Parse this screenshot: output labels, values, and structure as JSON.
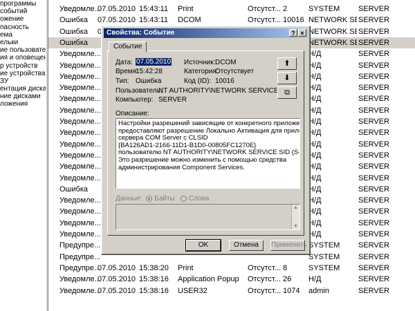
{
  "tree": [
    "программы",
    "событий",
    "ожение",
    "пасность",
    "ема",
    "ельки",
    "ие пользователи",
    "ия и оповещения пр",
    "р устройств",
    "ие устройства",
    "ЗУ",
    "ентация диска",
    "ние дисками",
    "ложения"
  ],
  "events": [
    {
      "icon": "info",
      "type": "Уведомле...",
      "date": "07.05.2010",
      "time": "15:43:11",
      "source": "Print",
      "category": "Отсутст...",
      "event": "2",
      "user": "SYSTEM",
      "computer": "SERVER"
    },
    {
      "icon": "error",
      "type": "Ошибка",
      "date": "07.05.2010",
      "time": "15:43:11",
      "source": "DCOM",
      "category": "Отсутст...",
      "event": "10016",
      "user": "NETWORK SER...",
      "computer": "SERVER"
    },
    {
      "icon": "error",
      "type": "Ошибка",
      "date": "07.05.2010",
      "time": "15:42:28",
      "source": "DCOM",
      "category": "Отсутст...",
      "event": "10016",
      "user": "NETWORK SER...",
      "computer": "SERVER"
    },
    {
      "icon": "error",
      "type": "Ошибка",
      "date": "",
      "time": "",
      "source": "",
      "category": "",
      "event": "",
      "user": "NETWORK SER...",
      "computer": "SERVER",
      "selected": true
    },
    {
      "icon": "info",
      "type": "Уведомле...",
      "date": "",
      "time": "",
      "source": "",
      "category": "",
      "event": "",
      "user": "Н/Д",
      "computer": "SERVER"
    },
    {
      "icon": "info",
      "type": "Уведомле...",
      "date": "",
      "time": "",
      "source": "",
      "category": "",
      "event": "",
      "user": "Н/Д",
      "computer": "SERVER"
    },
    {
      "icon": "info",
      "type": "Уведомле...",
      "date": "",
      "time": "",
      "source": "",
      "category": "",
      "event": "",
      "user": "Н/Д",
      "computer": "SERVER"
    },
    {
      "icon": "info",
      "type": "Уведомле...",
      "date": "",
      "time": "",
      "source": "",
      "category": "",
      "event": "",
      "user": "Н/Д",
      "computer": "SERVER"
    },
    {
      "icon": "info",
      "type": "Уведомле...",
      "date": "",
      "time": "",
      "source": "",
      "category": "",
      "event": "",
      "user": "Н/Д",
      "computer": "SERVER"
    },
    {
      "icon": "info",
      "type": "Уведомле...",
      "date": "",
      "time": "",
      "source": "",
      "category": "",
      "event": "",
      "user": "Н/Д",
      "computer": "SERVER"
    },
    {
      "icon": "info",
      "type": "Уведомле...",
      "date": "",
      "time": "",
      "source": "",
      "category": "",
      "event": "",
      "user": "Н/Д",
      "computer": "SERVER"
    },
    {
      "icon": "info",
      "type": "Уведомле...",
      "date": "",
      "time": "",
      "source": "",
      "category": "",
      "event": "",
      "user": "Н/Д",
      "computer": "SERVER"
    },
    {
      "icon": "info",
      "type": "Уведомле...",
      "date": "",
      "time": "",
      "source": "",
      "category": "",
      "event": "",
      "user": "Н/Д",
      "computer": "SERVER"
    },
    {
      "icon": "info",
      "type": "Уведомле...",
      "date": "",
      "time": "",
      "source": "",
      "category": "",
      "event": "",
      "user": "Н/Д",
      "computer": "SERVER"
    },
    {
      "icon": "info",
      "type": "Уведомле...",
      "date": "",
      "time": "",
      "source": "",
      "category": "",
      "event": "",
      "user": "Н/Д",
      "computer": "SERVER"
    },
    {
      "icon": "info",
      "type": "Уведомле...",
      "date": "",
      "time": "",
      "source": "",
      "category": "",
      "event": "",
      "user": "Н/Д",
      "computer": "SERVER"
    },
    {
      "icon": "error",
      "type": "Ошибка",
      "date": "",
      "time": "",
      "source": "",
      "category": "",
      "event": "",
      "user": "Н/Д",
      "computer": "SERVER"
    },
    {
      "icon": "info",
      "type": "Уведомле...",
      "date": "",
      "time": "",
      "source": "",
      "category": "",
      "event": "",
      "user": "Н/Д",
      "computer": "SERVER"
    },
    {
      "icon": "info",
      "type": "Уведомле...",
      "date": "",
      "time": "",
      "source": "",
      "category": "",
      "event": "",
      "user": "Н/Д",
      "computer": "SERVER"
    },
    {
      "icon": "info",
      "type": "Уведомле...",
      "date": "",
      "time": "",
      "source": "",
      "category": "",
      "event": "",
      "user": "Н/Д",
      "computer": "SERVER"
    },
    {
      "icon": "info",
      "type": "Уведомле...",
      "date": "",
      "time": "",
      "source": "",
      "category": "",
      "event": "",
      "user": "Н/Д",
      "computer": "SERVER"
    },
    {
      "icon": "warning",
      "type": "Предупре...",
      "date": "",
      "time": "",
      "source": "",
      "category": "",
      "event": "",
      "user": "SYSTEM",
      "computer": "SERVER"
    },
    {
      "icon": "warning",
      "type": "Предупре...",
      "date": "",
      "time": "",
      "source": "",
      "category": "",
      "event": "",
      "user": "SYSTEM",
      "computer": "SERVER"
    },
    {
      "icon": "warning",
      "type": "Предупре...",
      "date": "07.05.2010",
      "time": "15:38:20",
      "source": "Print",
      "category": "Отсутст...",
      "event": "8",
      "user": "SYSTEM",
      "computer": "SERVER"
    },
    {
      "icon": "info",
      "type": "Уведомле...",
      "date": "07.05.2010",
      "time": "15:38:16",
      "source": "Application Popup",
      "category": "Отсутст...",
      "event": "26",
      "user": "Н/Д",
      "computer": "SERVER"
    },
    {
      "icon": "info",
      "type": "Уведомле...",
      "date": "07.05.2010",
      "time": "15:38:16",
      "source": "USER32",
      "category": "Отсутст...",
      "event": "1074",
      "user": "admin",
      "computer": "SERVER"
    }
  ],
  "dialog": {
    "title": "Свойства: Событие",
    "help_btn": "?",
    "close_btn": "×",
    "tab": "Событие",
    "date_label": "Дата:",
    "date": "07.05.2010",
    "source_label": "Источник:",
    "source": "DCOM",
    "time_label": "Время:",
    "time": "15:42:28",
    "category_label": "Категория:",
    "category": "Отсутствует",
    "type_label": "Тип:",
    "type": "Ошибка",
    "code_label": "Код (ID):",
    "code": "10016",
    "user_label": "Пользователь:",
    "user": "NT AUTHORITY\\NETWORK SERVICE",
    "computer_label": "Компьютер:",
    "computer": "SERVER",
    "up_arrow": "⬆",
    "down_arrow": "⬇",
    "copy_icon": "⧉",
    "description_label": "Описание:",
    "description_lines": [
      "Настройки разрешений  зависящие от конкретного приложения не",
      "предоставляют разрешение Локально Активация для приложения",
      "сервера COM Server с CLSID",
      "{BA126AD1-2166-11D1-B1D0-00805FC1270E}",
      " пользователю NT AUTHORITY\\NETWORK SERVICE SID (S-1-5-20).",
      "Это разрешение  можно изменить с помощью средства",
      "администрирования Component Services."
    ],
    "data_label": "Данные:",
    "bytes_label": "Байты",
    "words_label": "Слова",
    "ok": "OK",
    "cancel": "Отмена",
    "apply": "Применить"
  },
  "colors": {
    "titlebar_start": "#0a246a",
    "titlebar_end": "#a6caf0",
    "dialog_face": "#d4d0c8",
    "info_icon": "#2a5bd7",
    "error_icon": "#c8281e",
    "warning_icon": "#f2d21a"
  }
}
